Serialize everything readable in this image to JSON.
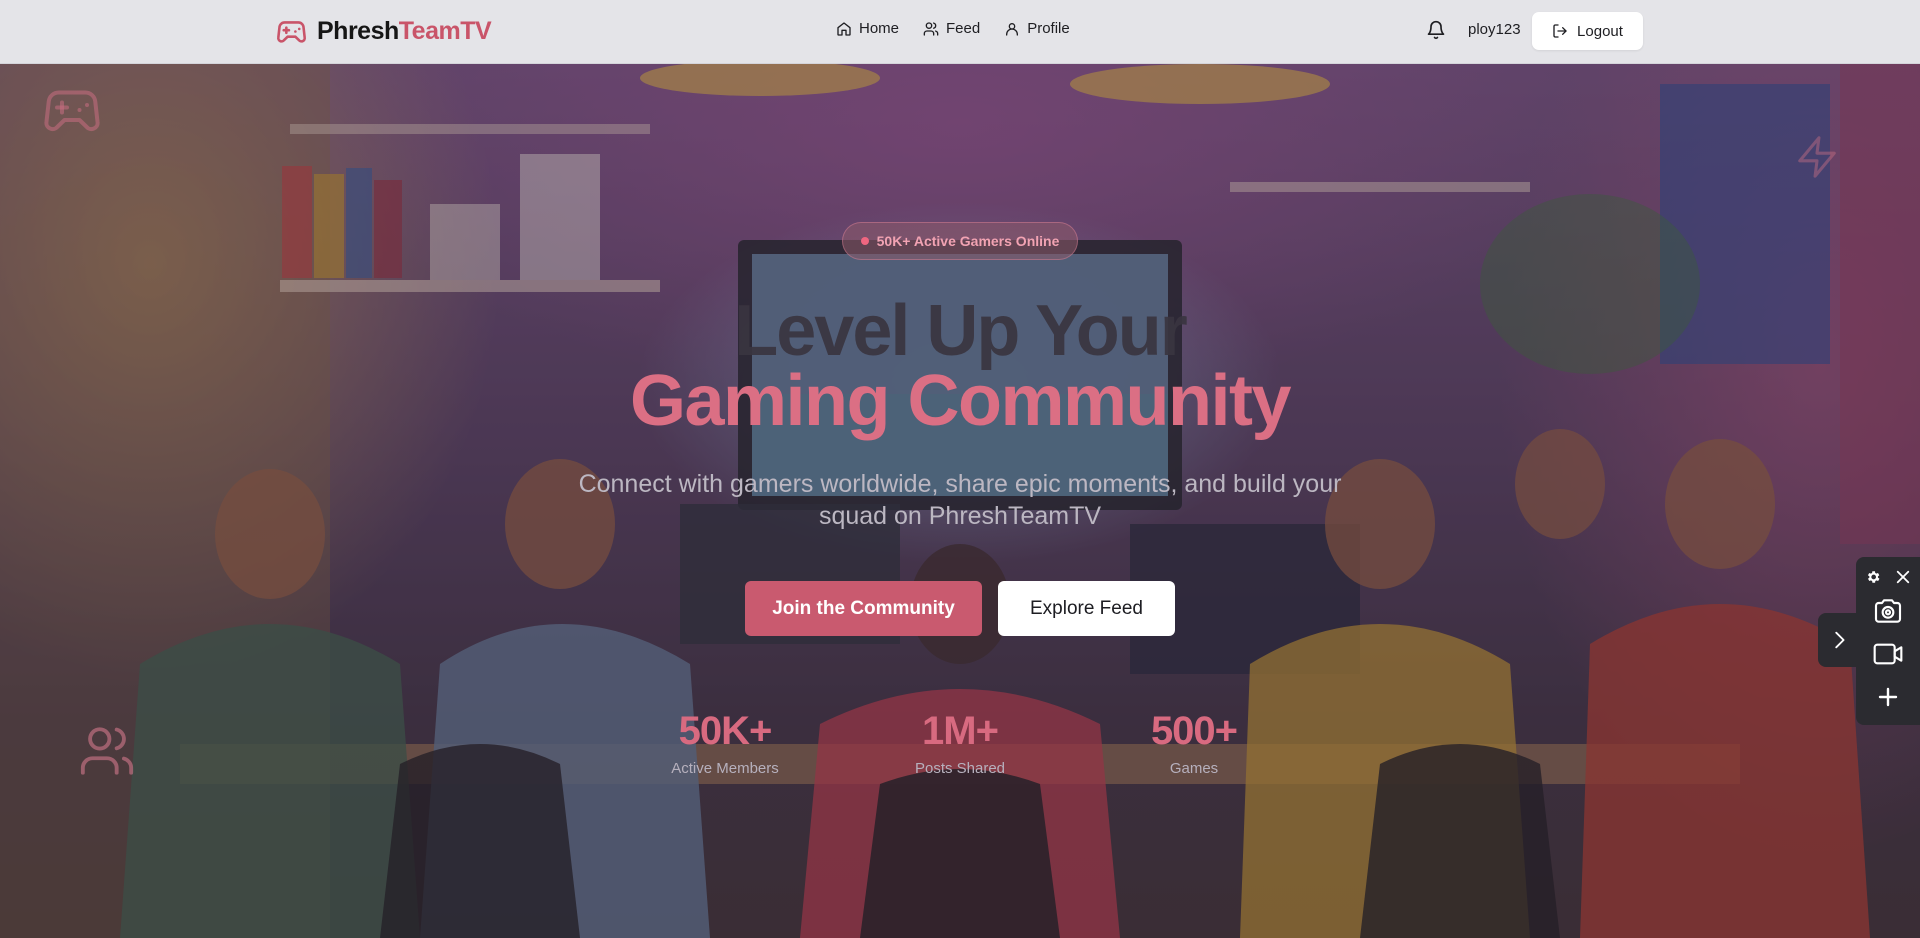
{
  "navbar": {
    "brand_prefix": "Phresh",
    "brand_accent": "TeamTV",
    "links": [
      {
        "label": "Home",
        "icon": "home-icon"
      },
      {
        "label": "Feed",
        "icon": "users-icon"
      },
      {
        "label": "Profile",
        "icon": "user-icon"
      }
    ],
    "username": "ploy123",
    "logout_label": "Logout"
  },
  "hero": {
    "badge": "50K+ Active Gamers Online",
    "headline_line1": "Level Up Your",
    "headline_line2": "Gaming Community",
    "subtitle": "Connect with gamers worldwide, share epic moments, and build your squad on PhreshTeamTV",
    "primary_cta": "Join the Community",
    "secondary_cta": "Explore Feed",
    "stats": [
      {
        "value": "50K+",
        "label": "Active Members"
      },
      {
        "value": "1M+",
        "label": "Posts Shared"
      },
      {
        "value": "500+",
        "label": "Games"
      }
    ]
  },
  "tool_panel": {
    "icons": [
      "gear-icon",
      "close-icon",
      "camera-icon",
      "video-icon",
      "plus-icon",
      "chevron-right-icon"
    ]
  },
  "colors": {
    "accent": "#c95469",
    "headline_accent": "#db6f84",
    "navbar_bg": "#e4e4e8",
    "primary_button": "#c95a6f"
  }
}
